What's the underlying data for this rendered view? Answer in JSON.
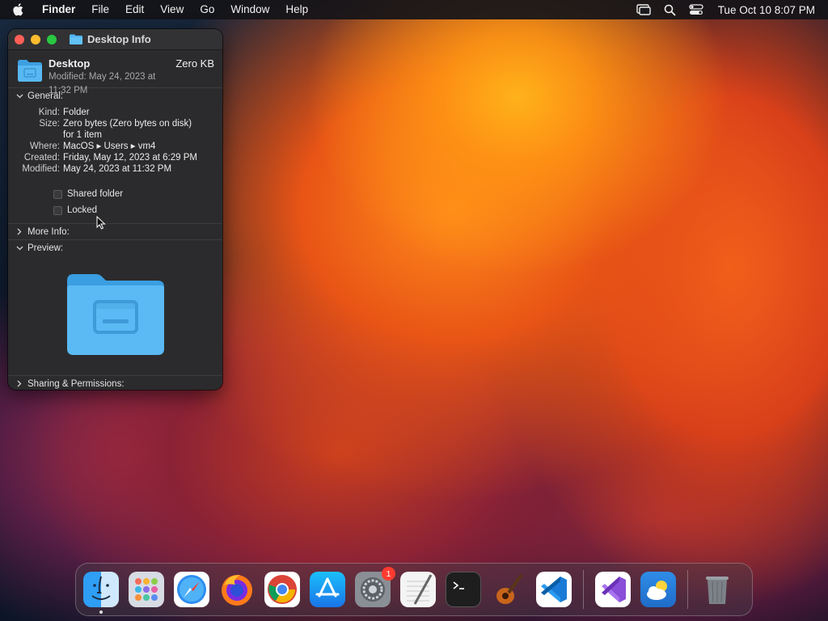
{
  "menubar": {
    "app_name": "Finder",
    "menus": [
      "File",
      "Edit",
      "View",
      "Go",
      "Window",
      "Help"
    ],
    "clock": "Tue Oct 10  8:07 PM"
  },
  "info_window": {
    "title": "Desktop Info",
    "item_name": "Desktop",
    "item_size": "Zero KB",
    "modified_line": "Modified: May 24, 2023 at 11:32 PM",
    "general": {
      "heading": "General:",
      "kind_label": "Kind:",
      "kind_value": "Folder",
      "size_label": "Size:",
      "size_value": "Zero bytes (Zero bytes on disk)",
      "size_value_2": "for 1 item",
      "where_label": "Where:",
      "where_value": "MacOS ▸ Users ▸ vm4",
      "created_label": "Created:",
      "created_value": "Friday, May 12, 2023 at 6:29 PM",
      "modified_label": "Modified:",
      "modified_value": "May 24, 2023 at 11:32 PM",
      "shared_folder_label": "Shared folder",
      "shared_folder_checked": false,
      "locked_label": "Locked",
      "locked_checked": false
    },
    "more_info_heading": "More Info:",
    "preview_heading": "Preview:",
    "sharing_heading": "Sharing & Permissions:"
  },
  "dock": {
    "items": [
      "finder-icon",
      "launchpad-icon",
      "safari-icon",
      "firefox-icon",
      "chrome-icon",
      "app-store-icon",
      "system-settings-icon",
      "textedit-icon",
      "terminal-icon",
      "garageband-icon",
      "vscode-icon",
      "visual-studio-icon",
      "weather-icon",
      "trash-icon"
    ],
    "settings_badge": "1"
  },
  "colors": {
    "window_bg": "#2b2b2d",
    "folder_blue": "#4fb3f0",
    "badge_red": "#ff3b30"
  }
}
